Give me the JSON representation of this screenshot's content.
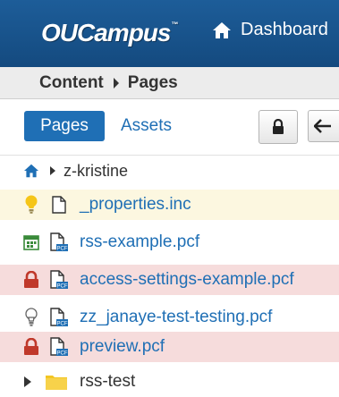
{
  "header": {
    "logo": "OUCampus",
    "logo_mark": "™",
    "dashboard_label": "Dashboard"
  },
  "breadcrumb": {
    "first": "Content",
    "second": "Pages"
  },
  "tabs": {
    "pages": "Pages",
    "assets": "Assets"
  },
  "location": {
    "folder": "z-kristine"
  },
  "files": [
    {
      "name": "_properties.inc",
      "status": "lightbulb-on",
      "type": "file"
    },
    {
      "name": "rss-example.pcf",
      "status": "calendar",
      "type": "pcf"
    },
    {
      "name": "access-settings-example.pcf",
      "status": "lock",
      "type": "pcf"
    },
    {
      "name": "zz_janaye-test-testing.pcf",
      "status": "lightbulb-off",
      "type": "pcf"
    },
    {
      "name": "preview.pcf",
      "status": "lock",
      "type": "pcf"
    },
    {
      "name": "rss-test",
      "status": "expand",
      "type": "folder"
    }
  ],
  "colors": {
    "header_bg": "#1a5592",
    "accent": "#1f6fb5",
    "row_checked_out": "#fcf7e0",
    "row_locked": "#f6dcdc",
    "lock_red": "#c0392b",
    "bulb_yellow": "#f5c518",
    "folder_yellow": "#f3c623"
  },
  "file_badge": "PCF"
}
